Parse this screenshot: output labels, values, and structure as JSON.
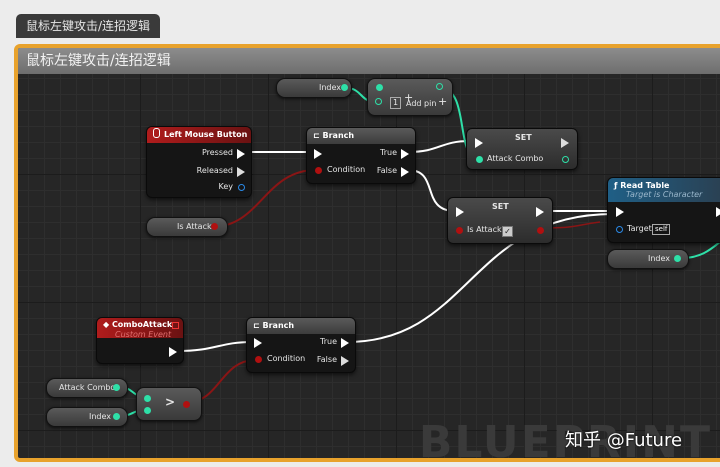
{
  "tab_title": "鼠标左键攻击/连招逻辑",
  "graph_title": "鼠标左键攻击/连招逻辑",
  "watermark": "BLUEPRINT",
  "credit": "知乎 @Future",
  "nodes": {
    "index_top": "Index",
    "addpin": {
      "count": "1",
      "label": "Add pin"
    },
    "left_mouse": {
      "title": "Left Mouse Button",
      "pressed": "Pressed",
      "released": "Released",
      "key": "Key"
    },
    "branch1": {
      "title": "Branch",
      "condition": "Condition",
      "true": "True",
      "false": "False"
    },
    "set1": {
      "title": "SET",
      "pin": "Attack Combo"
    },
    "set2": {
      "title": "SET",
      "pin": "Is Attack"
    },
    "is_attack": "Is Attack",
    "read_table": {
      "title": "Read Table",
      "subtitle": "Target is Character",
      "target": "Target",
      "self": "self"
    },
    "index_right": "Index",
    "combo_attack": {
      "title": "ComboAttack",
      "subtitle": "Custom Event"
    },
    "branch2": {
      "title": "Branch",
      "condition": "Condition",
      "true": "True",
      "false": "False"
    },
    "attack_combo_var": "Attack Combo",
    "index_bottom": "Index",
    "compare": ">"
  },
  "colors": {
    "frame": "#e8a22c",
    "exec_wire": "#ffffff",
    "bool_wire": "#8a1515",
    "int_wire": "#2ee0a8"
  }
}
